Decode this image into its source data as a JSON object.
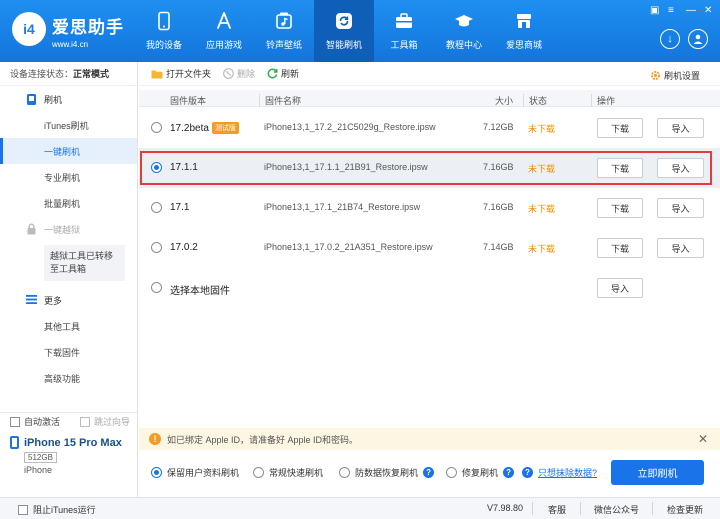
{
  "app": {
    "logo_text": "i4",
    "brand_name": "爱思助手",
    "brand_url": "www.i4.cn"
  },
  "nav": [
    {
      "label": "我的设备",
      "icon": "phone-icon"
    },
    {
      "label": "应用游戏",
      "icon": "app-store-icon"
    },
    {
      "label": "铃声壁纸",
      "icon": "music-wallpaper-icon"
    },
    {
      "label": "智能刷机",
      "icon": "flash-refresh-icon",
      "active": true
    },
    {
      "label": "工具箱",
      "icon": "toolbox-icon"
    },
    {
      "label": "教程中心",
      "icon": "graduation-cap-icon"
    },
    {
      "label": "爱思商城",
      "icon": "store-icon"
    }
  ],
  "sidebar": {
    "status_label": "设备连接状态：",
    "status_value": "正常模式",
    "flash_group": "刷机",
    "flash_items": [
      "iTunes刷机",
      "一键刷机",
      "专业刷机",
      "批量刷机"
    ],
    "jailbreak_group": "一键越狱",
    "jailbreak_note": "越狱工具已转移至工具箱",
    "more_group": "更多",
    "more_items": [
      "其他工具",
      "下载固件",
      "高级功能"
    ],
    "auto_activate": "自动激活",
    "skip_guide": "跳过向导",
    "device_name": "iPhone 15 Pro Max",
    "device_storage": "512GB",
    "device_model": "iPhone"
  },
  "toolbar": {
    "open_folder": "打开文件夹",
    "delete": "删除",
    "refresh": "刷新",
    "settings": "刷机设置"
  },
  "table": {
    "headers": [
      "固件版本",
      "固件名称",
      "大小",
      "状态",
      "操作"
    ],
    "download_label": "下载",
    "import_label": "导入",
    "rows": [
      {
        "version": "17.2beta",
        "badge": "测试版",
        "file": "iPhone13,1_17.2_21C5029g_Restore.ipsw",
        "size": "7.12GB",
        "status": "未下载",
        "selected": false
      },
      {
        "version": "17.1.1",
        "badge": "",
        "file": "iPhone13,1_17.1.1_21B91_Restore.ipsw",
        "size": "7.16GB",
        "status": "未下载",
        "selected": true
      },
      {
        "version": "17.1",
        "badge": "",
        "file": "iPhone13,1_17.1_21B74_Restore.ipsw",
        "size": "7.16GB",
        "status": "未下载",
        "selected": false
      },
      {
        "version": "17.0.2",
        "badge": "",
        "file": "iPhone13,1_17.0.2_21A351_Restore.ipsw",
        "size": "7.14GB",
        "status": "未下载",
        "selected": false
      }
    ],
    "local_option": "选择本地固件"
  },
  "notice": {
    "text": "如已绑定 Apple ID，请准备好 Apple ID和密码。"
  },
  "options": {
    "keep_data": "保留用户资料刷机",
    "normal_fast": "常规快速刷机",
    "anti_recovery": "防数据恢复刷机",
    "repair": "修复刷机",
    "erase_link": "只想抹除数据?",
    "flash_now": "立即刷机"
  },
  "footer": {
    "block_itunes": "阻止iTunes运行",
    "version": "V7.98.80",
    "support": "客服",
    "wechat": "微信公众号",
    "check_update": "检查更新"
  },
  "colors": {
    "primary": "#1a73e8",
    "header": "#1a7ee6",
    "warning": "#f08c00",
    "highlight_border": "#e43c3c"
  }
}
